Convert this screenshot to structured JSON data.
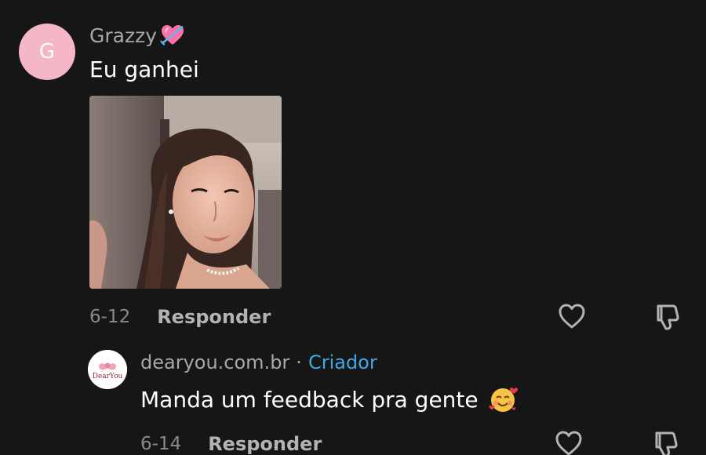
{
  "comment": {
    "avatar_letter": "G",
    "username": "Grazzy",
    "username_emoji": "💘",
    "text": "Eu ganhei",
    "date": "6-12",
    "reply_label": "Responder"
  },
  "reply": {
    "avatar_logo_text": "DearYou",
    "username": "dearyou.com.br",
    "separator": "·",
    "badge": "Criador",
    "text": "Manda um feedback pra gente",
    "emoji": "🥰",
    "date": "6-14",
    "reply_label": "Responder"
  },
  "colors": {
    "background": "#161616",
    "avatar_pink": "#f5b6c8",
    "creator_blue": "#3fa8e6",
    "muted_text": "#a8a8a8"
  },
  "icons": [
    "heart-icon",
    "dislike-icon"
  ]
}
